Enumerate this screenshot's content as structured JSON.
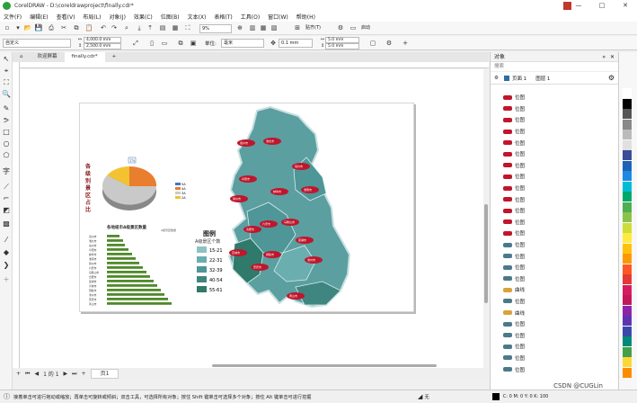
{
  "window": {
    "title": "CorelDRAW - D:\\coreldrawproject\\finally.cdr*",
    "min": "—",
    "max": "□",
    "close": "✕"
  },
  "menu": [
    "文件(F)",
    "编辑(E)",
    "查看(V)",
    "布局(L)",
    "对象(J)",
    "效果(C)",
    "位图(B)",
    "文本(X)",
    "表格(T)",
    "工具(O)",
    "窗口(W)",
    "帮助(H)"
  ],
  "toolbar": {
    "zoom": "9%",
    "snap": "贴齐(T)",
    "launch": "启动"
  },
  "propbar": {
    "preset": "自定义",
    "width": "4,000.0 mm",
    "height": "2,500.0 mm",
    "units_label": "单位:",
    "units": "毫米",
    "nudge": "0.1 mm",
    "dup_x": "5.0 mm",
    "dup_y": "5.0 mm"
  },
  "tabs": [
    "欢迎屏幕",
    "finally.cdr*"
  ],
  "pagenav": {
    "first": "⏮",
    "prev": "◀",
    "pos": "1 的 1",
    "next": "▶",
    "last": "⏭",
    "page_tab": "页1"
  },
  "status": {
    "hint": "接着单击可进行拖动或缩放；再单击可旋转或倾斜；双击工具，可选择所有对象；按住 Shift 键单击可选择多个对象；按住 Alt 键单击可进行挖掘",
    "fill": "无",
    "cmyk": "C: 0 M: 0 Y: 0 K: 100",
    "watermark": "CSDN @CUGLin"
  },
  "panel": {
    "title": "对象",
    "search": "搜索",
    "page": "页面 1",
    "layer": "图层 1",
    "objects": [
      "位图",
      "位图",
      "位图",
      "位图",
      "位图",
      "位图",
      "位图",
      "位图",
      "位图",
      "位图",
      "位图",
      "位图",
      "位图",
      "位图",
      "位图",
      "位图",
      "位图",
      "曲线",
      "位图",
      "曲线",
      "位图",
      "位图",
      "位图",
      "位图",
      "位图"
    ]
  },
  "design": {
    "pie_title": [
      "各",
      "级",
      "别",
      "景",
      "区",
      "占",
      "比"
    ],
    "pie_legend": [
      "5A",
      "4A",
      "3A",
      "2A"
    ],
    "pie_pct": "1%",
    "bar_title": "各地级市A级景区数量",
    "bar_legend": "A级景区数量",
    "legend_title": "图例",
    "legend_sub": "A级景区个数",
    "legend_ranges": [
      "15-21",
      "22-31",
      "32-39",
      "40-54",
      "55-61"
    ],
    "cities": [
      "宿州市",
      "淮北市",
      "亳州市",
      "阜阳市",
      "蚌埠市",
      "淮南市",
      "滁州市",
      "六安市",
      "马鞍山市",
      "合肥市",
      "芜湖市",
      "宣城市",
      "铜陵市",
      "池州市",
      "安庆市",
      "黄山市"
    ]
  },
  "colors": {
    "accent": "#2e6da4",
    "map_fill": "#5b9fa0",
    "map_dark": "#2f7a6a",
    "badge": "#c0162c",
    "bars": "#4f8a2a"
  }
}
